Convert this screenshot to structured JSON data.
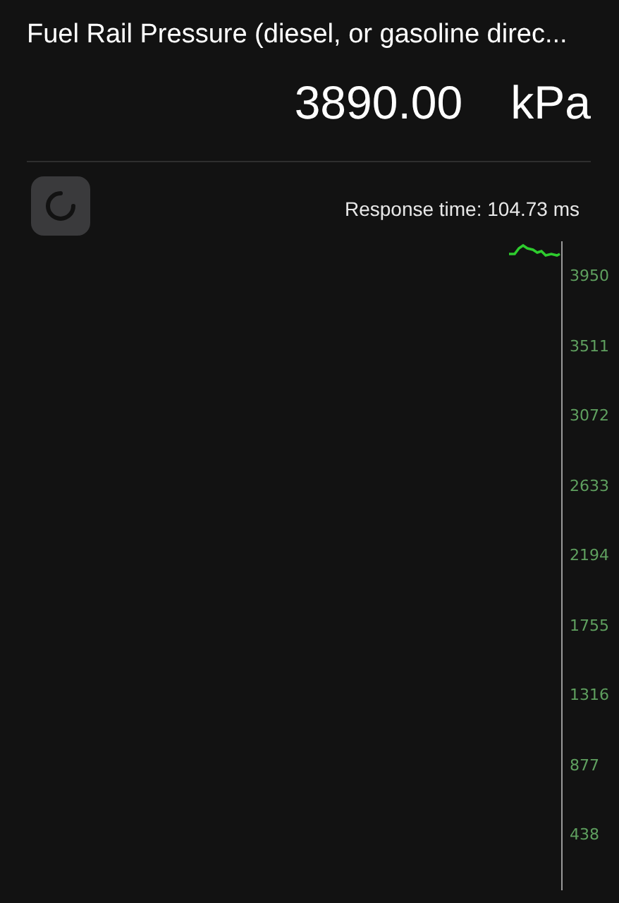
{
  "title": "Fuel Rail Pressure (diesel, or gasoline direc...",
  "reading": {
    "value": "3890.00",
    "unit": "kPa"
  },
  "response_time": "Response time: 104.73 ms",
  "graph": {
    "axis_labels": [
      "3950",
      "3511",
      "3072",
      "2633",
      "2194",
      "1755",
      "1316",
      "877",
      "438"
    ]
  }
}
